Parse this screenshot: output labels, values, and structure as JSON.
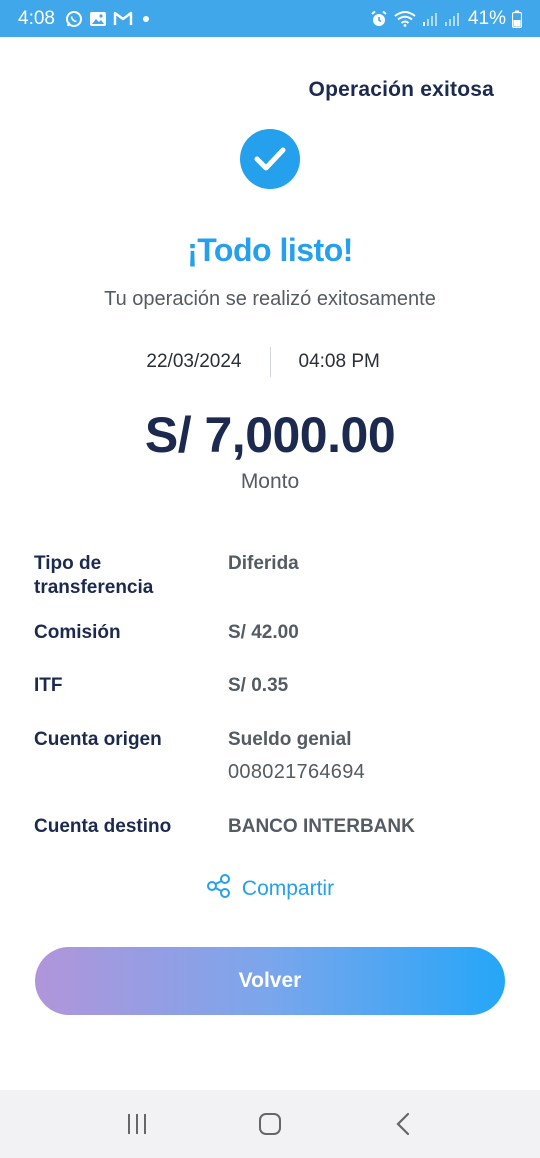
{
  "status_bar": {
    "time": "4:08",
    "battery": "41%",
    "left_icons": [
      "whatsapp-icon",
      "gallery-icon",
      "gmail-icon"
    ],
    "right_icons": [
      "alarm-icon",
      "wifi-icon",
      "signal-icon",
      "signal-icon",
      "battery-icon"
    ]
  },
  "header": {
    "title": "Operación exitosa"
  },
  "result": {
    "icon": "check-circle-icon",
    "headline": "¡Todo listo!",
    "subtitle": "Tu operación se realizó exitosamente"
  },
  "datetime": {
    "date": "22/03/2024",
    "time": "04:08 PM"
  },
  "amount": {
    "value": "S/ 7,000.00",
    "label": "Monto"
  },
  "details": {
    "transfer_type": {
      "label": "Tipo de transferencia",
      "value": "Diferida"
    },
    "commission": {
      "label": "Comisión",
      "value": "S/ 42.00"
    },
    "itf": {
      "label": "ITF",
      "value": "S/ 0.35"
    },
    "origin_account": {
      "label": "Cuenta origen",
      "value": "Sueldo genial",
      "number": "008021764694"
    },
    "destination_account": {
      "label": "Cuenta destino",
      "value": "BANCO INTERBANK"
    }
  },
  "actions": {
    "share_label": "Compartir",
    "share_icon": "share-icon",
    "back_label": "Volver"
  },
  "colors": {
    "status_bar": "#40a8ea",
    "accent": "#25a0ec",
    "navy": "#1c2a4f",
    "gradient_start": "#b195da",
    "gradient_end": "#25a6f8"
  },
  "nav_bar": {
    "icons": [
      "recents-icon",
      "home-icon",
      "back-icon"
    ]
  }
}
